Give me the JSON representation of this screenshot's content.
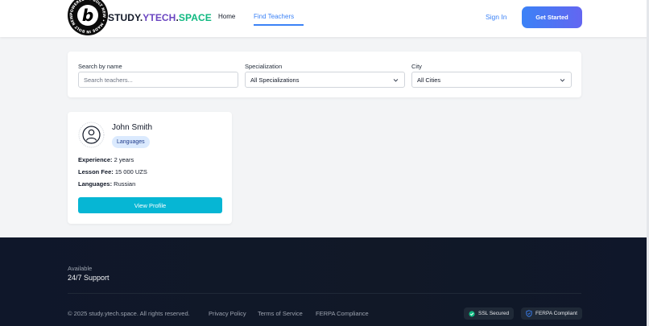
{
  "header": {
    "badge_letter": "b",
    "badge_ring_text": "POWERED BY BOLT NEW • MADE IN BOLT NEW •",
    "brand": {
      "part1": "STUDY.",
      "part2": "YTECH",
      "part3": ".",
      "part4": "SPACE"
    },
    "nav": {
      "home": "Home",
      "find_teachers": "Find Teachers"
    },
    "sign_in": "Sign In",
    "get_started": "Get Started"
  },
  "filters": {
    "name_label": "Search by name",
    "name_placeholder": "Search teachers...",
    "specialization_label": "Specialization",
    "specialization_value": "All Specializations",
    "city_label": "City",
    "city_value": "All Cities"
  },
  "teacher": {
    "name": "John Smith",
    "tag": "Languages",
    "experience_label": "Experience:",
    "experience_value": " 2 years",
    "fee_label": "Lesson Fee:",
    "fee_value": " 15 000 UZS",
    "languages_label": "Languages:",
    "languages_value": " Russian",
    "view_profile": "View Profile"
  },
  "footer": {
    "available": "Available",
    "support": "24/7 Support",
    "copyright": "© 2025 study.ytech.space. All rights reserved.",
    "privacy": "Privacy Policy",
    "terms": "Terms of Service",
    "ferpa": "FERPA Compliance",
    "ssl": "SSL Secured",
    "ferpa_badge": "FERPA Compliant"
  },
  "colors": {
    "accent": "#3b82f6",
    "button": "#06b6d4",
    "ssl_green": "#10b981",
    "ferpa_blue": "#3b82f6"
  }
}
